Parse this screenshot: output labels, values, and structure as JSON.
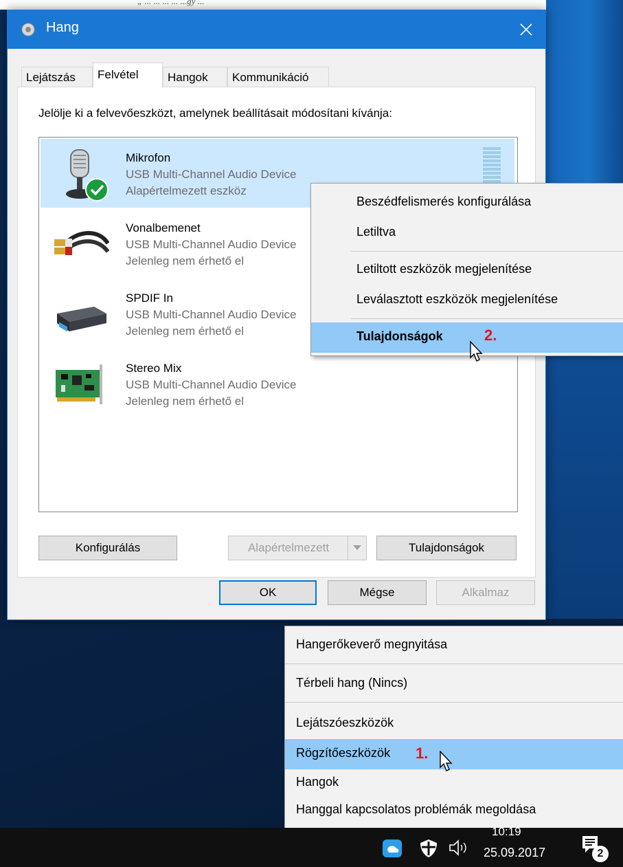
{
  "top_strip_text": "„ ... ... ... ... ...gy ...",
  "dialog": {
    "title": "Hang",
    "close_glyph": "✕",
    "tabs": [
      {
        "label": "Lejátszás",
        "active": false
      },
      {
        "label": "Felvétel",
        "active": true
      },
      {
        "label": "Hangok",
        "active": false
      },
      {
        "label": "Kommunikáció",
        "active": false
      }
    ],
    "instruction": "Jelölje ki a felvevőeszközt, amelynek beállításait módosítani kívánja:",
    "devices": [
      {
        "name": "Mikrofon",
        "description": "USB Multi-Channel Audio Device",
        "status": "Alapértelmezett eszköz",
        "icon": "microphone-icon",
        "selected": true,
        "default_check": true
      },
      {
        "name": "Vonalbemenet",
        "description": "USB Multi-Channel Audio Device",
        "status": "Jelenleg nem érhető el",
        "icon": "rca-cable-icon",
        "selected": false
      },
      {
        "name": "SPDIF In",
        "description": "USB Multi-Channel Audio Device",
        "status": "Jelenleg nem érhető el",
        "icon": "spdif-box-icon",
        "selected": false
      },
      {
        "name": "Stereo Mix",
        "description": "USB Multi-Channel Audio Device",
        "status": "Jelenleg nem érhető el",
        "icon": "sound-card-icon",
        "selected": false
      }
    ],
    "buttons": {
      "configure": "Konfigurálás",
      "set_default": "Alapértelmezett",
      "properties": "Tulajdonságok",
      "ok": "OK",
      "cancel": "Mégse",
      "apply": "Alkalmaz"
    }
  },
  "device_context_menu": {
    "items": [
      {
        "label": "Beszédfelismerés konfigurálása"
      },
      {
        "label": "Letiltva"
      },
      {
        "label": "Letiltott eszközök megjelenítése"
      },
      {
        "label": "Leválasztott eszközök megjelenítése"
      },
      {
        "label": "Tulajdonságok",
        "bold": true,
        "highlighted": true,
        "step": "2."
      }
    ]
  },
  "tray_context_menu": {
    "items": [
      {
        "label": "Hangerőkeverő megnyitása"
      },
      {
        "label": "Térbeli hang (Nincs)"
      },
      {
        "label": "Lejátszóeszközök"
      },
      {
        "label": "Rögzítőeszközök",
        "highlighted": true,
        "step": "1."
      },
      {
        "label": "Hangok"
      },
      {
        "label": "Hanggal kapcsolatos problémák megoldása"
      }
    ]
  },
  "taskbar": {
    "time": "10:19",
    "date": "25.09.2017",
    "notification_count": "2"
  },
  "colors": {
    "accent": "#1a78d4",
    "selection": "#cce8ff",
    "menu_highlight": "#91c9f7",
    "step_number": "#e81123"
  }
}
